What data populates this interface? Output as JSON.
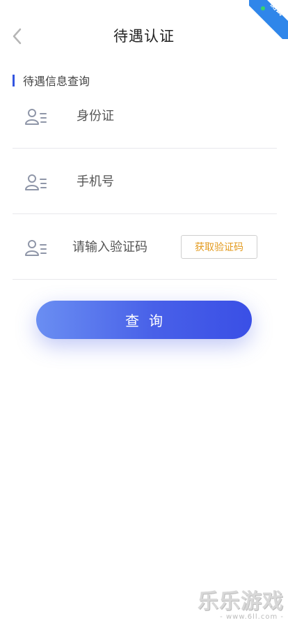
{
  "header": {
    "title": "待遇认证",
    "back_icon": "chevron-left-icon",
    "corner_badge": "测试"
  },
  "section": {
    "label": "待遇信息查询",
    "accent_color": "#3355e0"
  },
  "form": {
    "id_field": {
      "placeholder": "身份证",
      "value": "",
      "icon": "user-list-icon"
    },
    "phone_field": {
      "placeholder": "手机号",
      "value": "",
      "icon": "user-list-icon"
    },
    "code_field": {
      "placeholder": "请输入验证码",
      "value": "",
      "icon": "user-list-icon"
    },
    "get_code_label": "获取验证码",
    "get_code_color": "#e39a1d"
  },
  "actions": {
    "query_label": "查询",
    "query_gradient": [
      "#6a8ef2",
      "#3a4fe6"
    ]
  },
  "watermark": {
    "main": "乐乐游戏",
    "sub": "- www.6ll.com -"
  }
}
